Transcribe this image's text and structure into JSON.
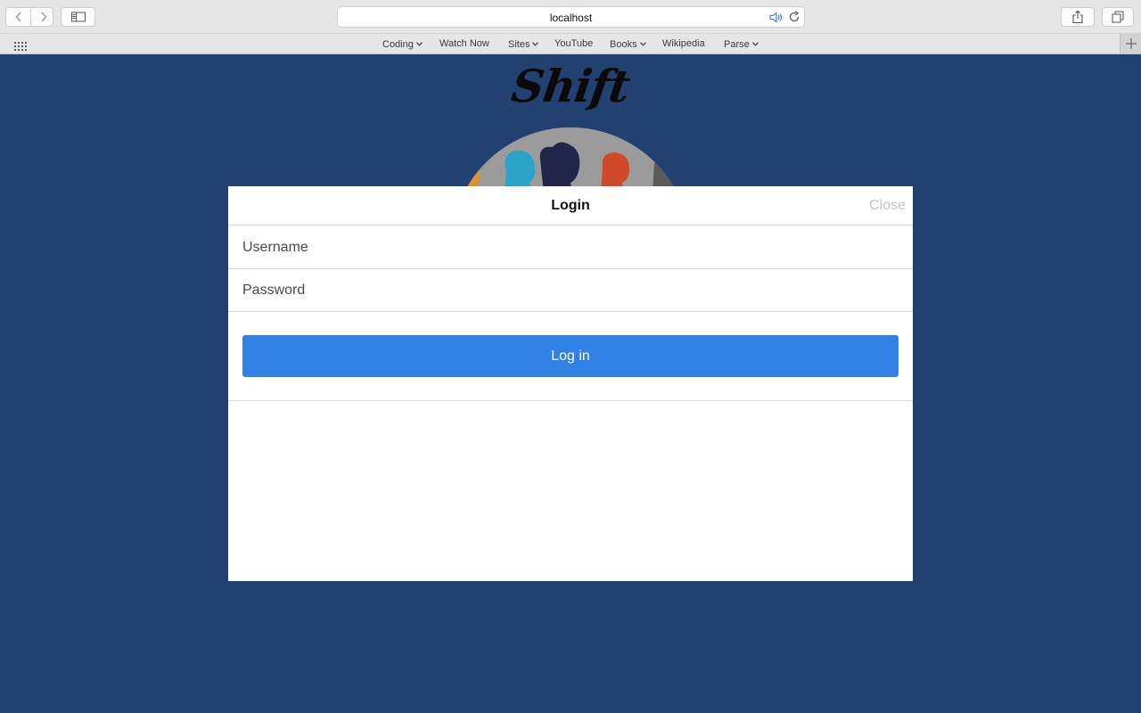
{
  "browser": {
    "url": "localhost",
    "bookmarks": [
      {
        "label": "Coding",
        "has_menu": true
      },
      {
        "label": "Watch Now",
        "has_menu": false
      },
      {
        "label": "Sites",
        "has_menu": true
      },
      {
        "label": "YouTube",
        "has_menu": false
      },
      {
        "label": "Books",
        "has_menu": true
      },
      {
        "label": "Wikipedia",
        "has_menu": false
      },
      {
        "label": "Parse",
        "has_menu": true
      }
    ],
    "icons": {
      "back": "chevron-left-icon",
      "forward": "chevron-right-icon",
      "sidebar": "sidebar-icon",
      "audio": "speaker-icon",
      "reload": "reload-icon",
      "share": "share-icon",
      "tabs": "tabs-overview-icon",
      "top_sites": "grid-icon",
      "new_tab": "plus-icon"
    }
  },
  "page": {
    "logo": "Shift",
    "background_color": "#224170"
  },
  "modal": {
    "title": "Login",
    "close_label": "Close",
    "username_placeholder": "Username",
    "password_placeholder": "Password",
    "login_button": "Log in",
    "accent_color": "#3180e6"
  }
}
